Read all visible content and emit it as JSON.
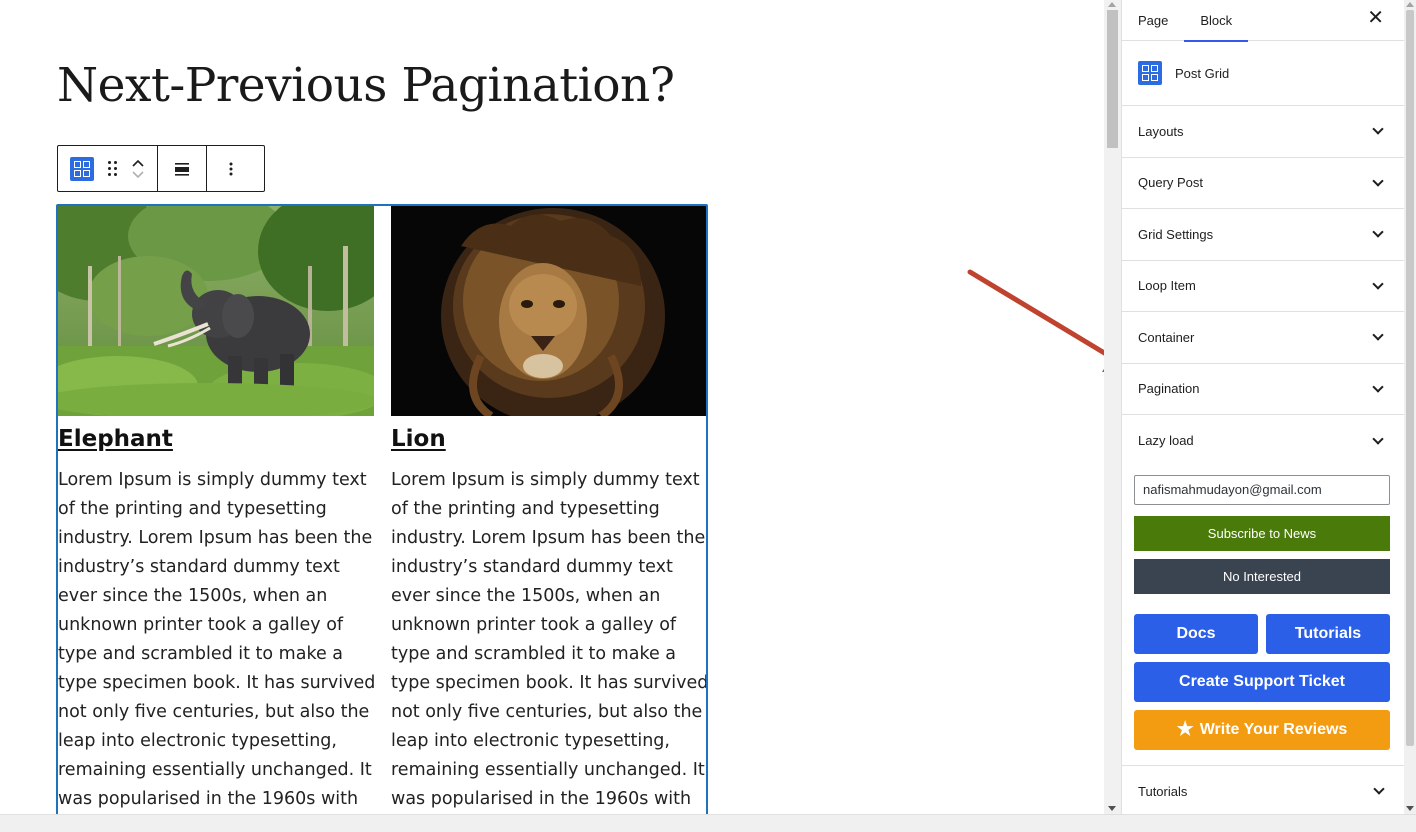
{
  "editor": {
    "title": "Next-Previous Pagination?",
    "toolbar": {
      "block_icon": "post-grid-icon",
      "drag_icon": "drag-handle-icon",
      "move_up_icon": "chevron-up-icon",
      "move_down_icon": "chevron-down-icon",
      "align_icon": "align-icon",
      "options_icon": "more-vertical-icon"
    },
    "posts": [
      {
        "title": "Elephant",
        "image": "elephant-photo",
        "excerpt": "Lorem Ipsum is simply dummy text of the printing and typesetting industry. Lorem Ipsum has been the industry’s standard dummy text ever since the 1500s, when an unknown printer took a galley of type and scrambled it to make a type specimen book. It has survived not only five centuries, but also the leap into electronic typesetting, remaining essentially unchanged. It was popularised in the 1960s with the release of Letraset sheets containing"
      },
      {
        "title": "Lion",
        "image": "lion-photo",
        "excerpt": "Lorem Ipsum is simply dummy text of the printing and typesetting industry. Lorem Ipsum has been the industry’s standard dummy text ever since the 1500s, when an unknown printer took a galley of type and scrambled it to make a type specimen book. It has survived not only five centuries, but also the leap into electronic typesetting, remaining essentially unchanged. It was popularised in the 1960s with the release of Letraset sheets containing"
      }
    ]
  },
  "sidebar": {
    "tabs": [
      "Page",
      "Block"
    ],
    "active_tab": "Block",
    "close_icon": "close-icon",
    "block_name": "Post Grid",
    "panels": [
      "Layouts",
      "Query Post",
      "Grid Settings",
      "Loop Item",
      "Container",
      "Pagination",
      "Lazy load"
    ],
    "promo": {
      "email_value": "nafismahmudayon@gmail.com",
      "subscribe_label": "Subscribe to News",
      "dismiss_label": "No Interested",
      "docs_label": "Docs",
      "tutorials_label": "Tutorials",
      "support_label": "Create Support Ticket",
      "review_label": "Write Your Reviews"
    },
    "bottom_panel": "Tutorials"
  },
  "colors": {
    "accent": "#2b5fe8",
    "block_selection": "#1e73be",
    "subscribe_green": "#4a7a0a",
    "dismiss_dark": "#3a4350",
    "review_orange": "#f39c12",
    "annotation_arrow": "#c0432f"
  }
}
